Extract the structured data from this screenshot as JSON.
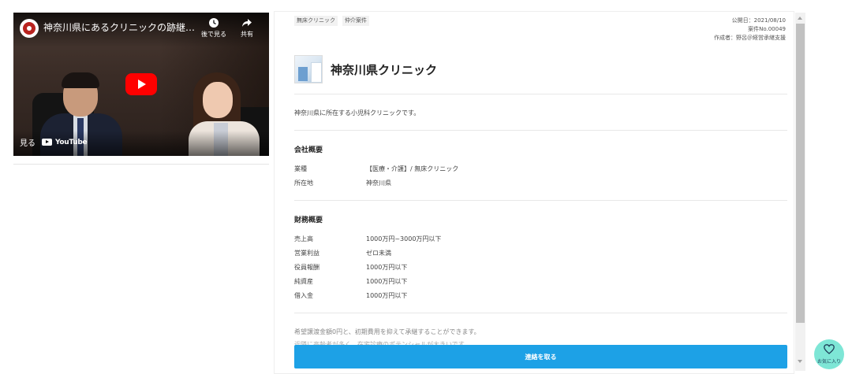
{
  "video": {
    "title": "神奈川県にあるクリニックの跡継ぎを…",
    "watch_later_label": "後で見る",
    "share_label": "共有",
    "watch_on_label": "見る",
    "youtube_label": "YouTube"
  },
  "tags": [
    "無床クリニック",
    "仲介案件"
  ],
  "meta": {
    "published": "公開日：2021/08/10",
    "case_no": "案件No.00049",
    "author": "作成者：野呂＠経営承継支援"
  },
  "company": {
    "name": "神奈川県クリニック",
    "description": "神奈川県に所在する小児科クリニックです。"
  },
  "overview": {
    "title": "会社概要",
    "rows": [
      {
        "key": "業種",
        "value": "【医療・介護】/ 無床クリニック"
      },
      {
        "key": "所在地",
        "value": "神奈川県"
      }
    ]
  },
  "finance": {
    "title": "財務概要",
    "rows": [
      {
        "key": "売上高",
        "value": "1000万円~3000万円以下"
      },
      {
        "key": "営業利益",
        "value": "ゼロ未満"
      },
      {
        "key": "役員報酬",
        "value": "1000万円以下"
      },
      {
        "key": "純資産",
        "value": "1000万円以下"
      },
      {
        "key": "借入金",
        "value": "1000万円以下"
      }
    ]
  },
  "footer": {
    "line1": "希望譲渡金額0円と、初期費用を抑えて承継することができます。",
    "line2": "近隣に高齢者が多く、在宅診療のポテンシャルが大きいです。"
  },
  "cta_label": "連絡を取る",
  "favorite_label": "お気に入り",
  "icons": {
    "clock": "clock-icon",
    "share": "share-arrow-icon",
    "play": "play-icon",
    "heart": "heart-icon"
  },
  "colors": {
    "cta": "#1da1e6",
    "favorite": "#7ee6d6",
    "youtube_red": "#ff0000"
  }
}
